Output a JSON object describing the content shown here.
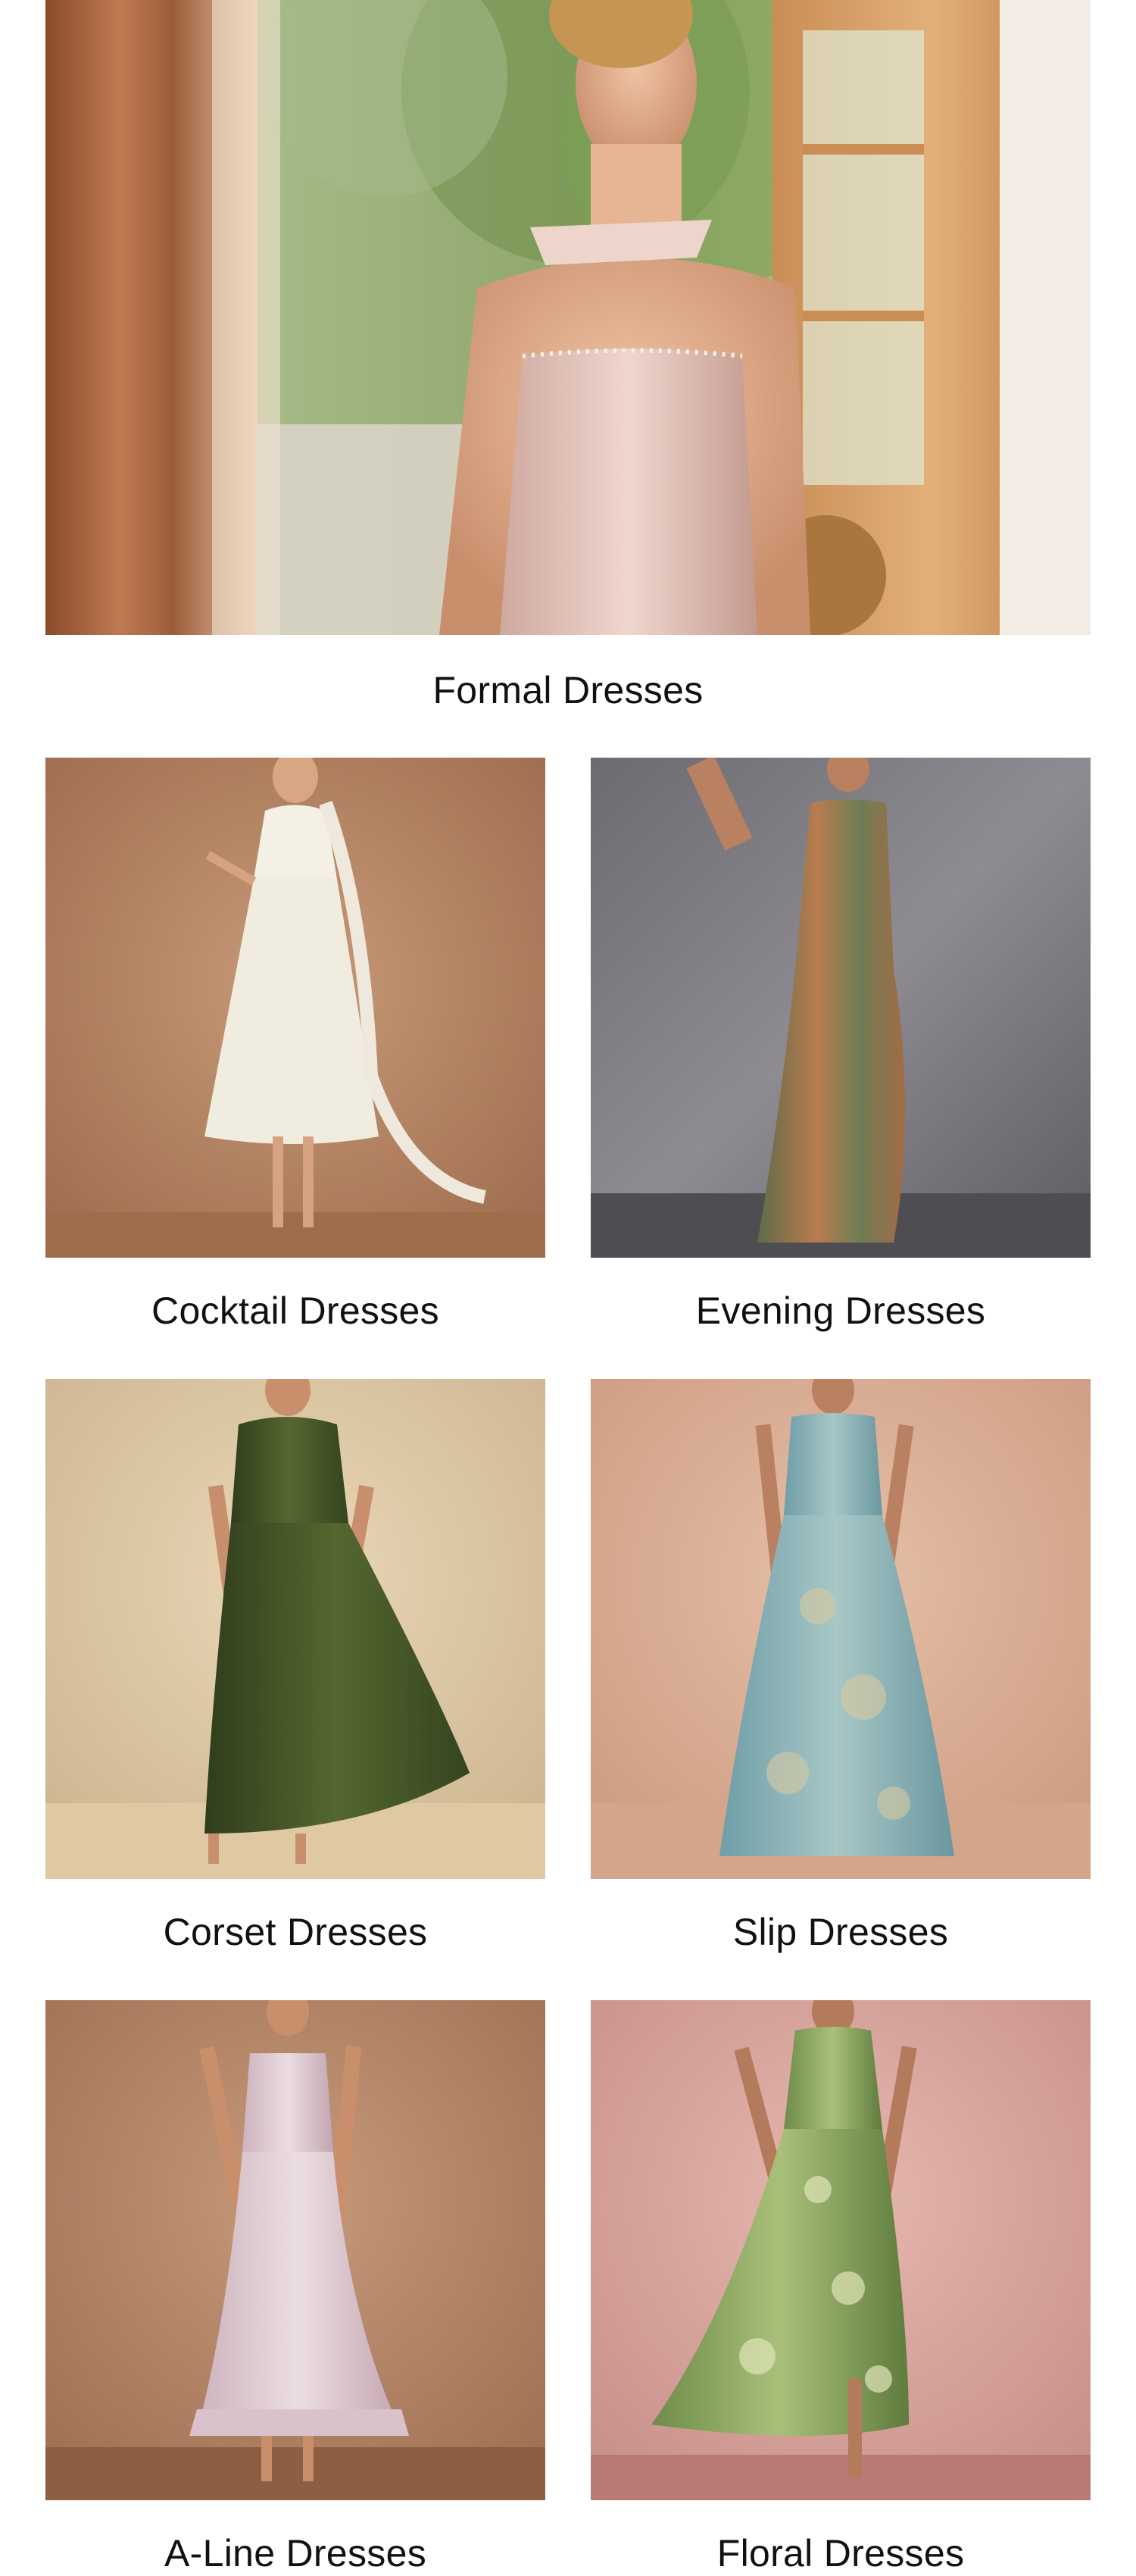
{
  "hero": {
    "title": "Formal Dresses",
    "image_alt": "Woman in blush strapless corset gown by a sunlit doorway"
  },
  "categories": [
    {
      "label": "Cocktail Dresses",
      "image_alt": "White jacquard midi dress with long scarf"
    },
    {
      "label": "Evening Dresses",
      "image_alt": "Bronze and teal brocade mermaid gown"
    },
    {
      "label": "Corset Dresses",
      "image_alt": "Olive green pleated satin corset gown"
    },
    {
      "label": "Slip Dresses",
      "image_alt": "Light blue floral jacquard maxi dress"
    },
    {
      "label": "A-Line Dresses",
      "image_alt": "Lavender floral strapless maxi dress"
    },
    {
      "label": "Floral Dresses",
      "image_alt": "Green floral maxi dress with slit"
    }
  ],
  "colors": {
    "text": "#111111",
    "background": "#ffffff"
  }
}
